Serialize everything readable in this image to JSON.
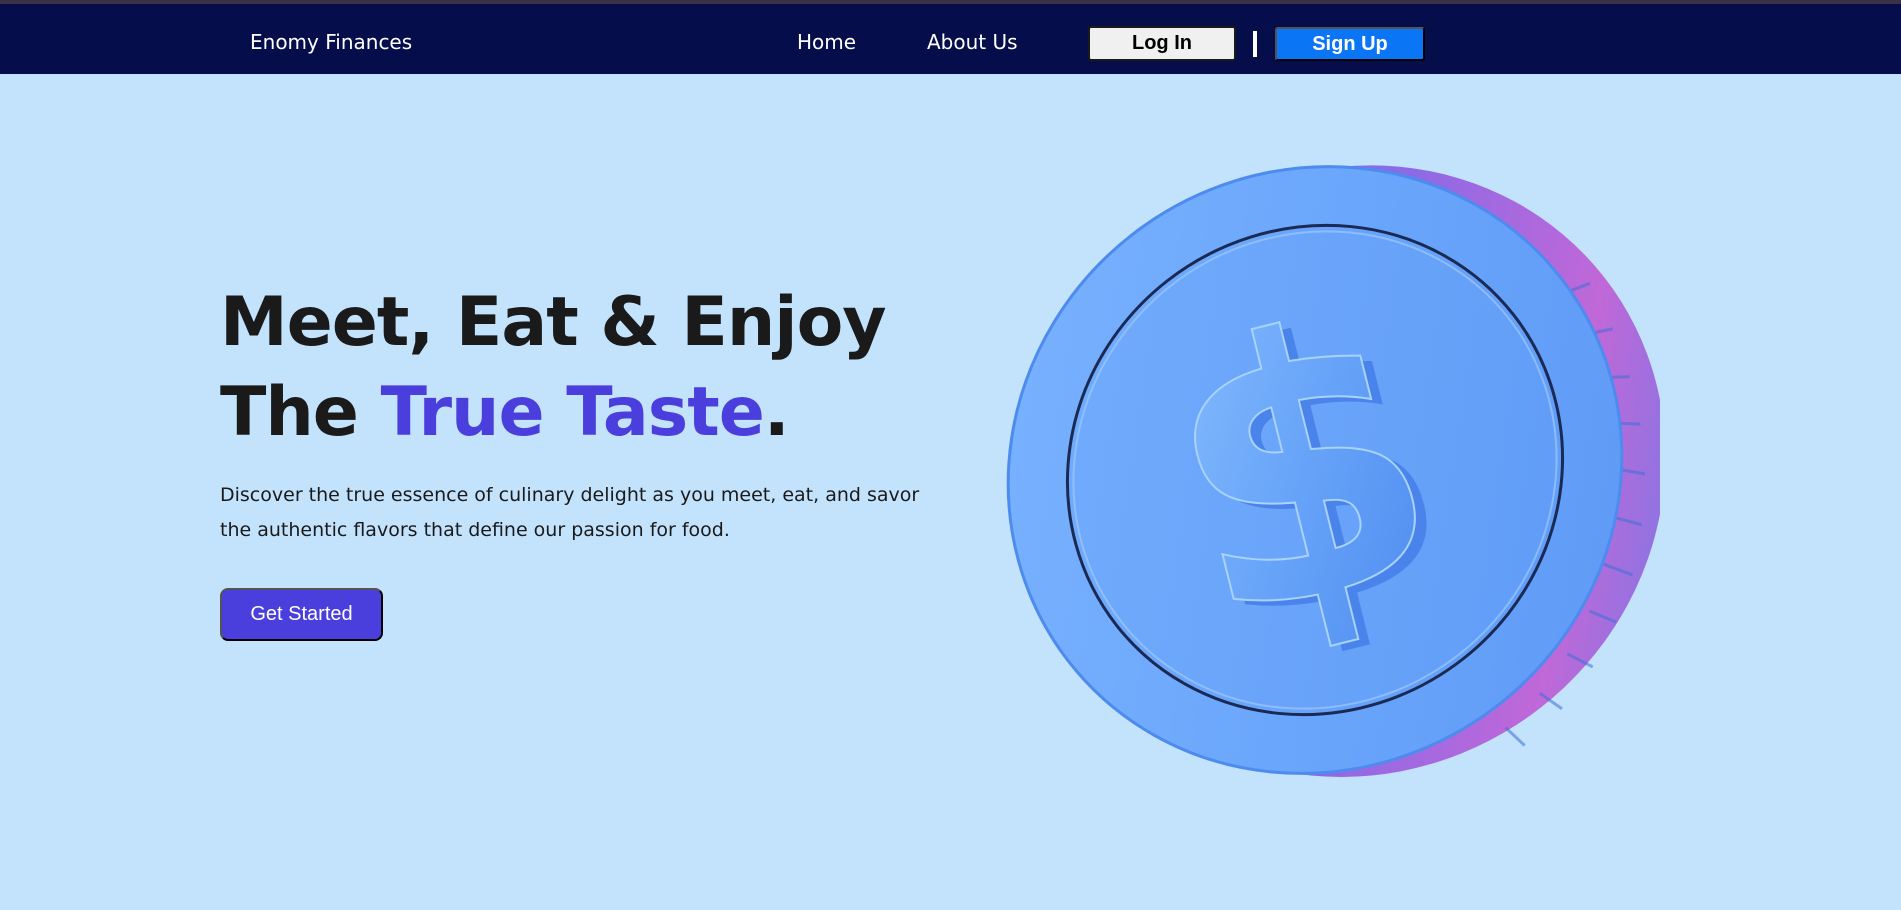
{
  "navbar": {
    "brand": "Enomy Finances",
    "links": [
      {
        "label": "Home"
      },
      {
        "label": "About Us"
      }
    ],
    "login_label": "Log In",
    "signup_label": "Sign Up"
  },
  "hero": {
    "headline_line1": "Meet, Eat & Enjoy",
    "headline_line2_prefix": "The ",
    "headline_line2_accent": "True Taste",
    "headline_line2_suffix": ".",
    "description": "Discover the true essence of culinary delight as you meet, eat, and savor the authentic flavors that define our passion for food.",
    "cta_label": "Get Started"
  },
  "illustration": {
    "icon": "dollar-coin-icon"
  },
  "colors": {
    "navbar_bg": "#050e4b",
    "page_bg": "#c3e3fd",
    "accent": "#4a3fdd",
    "signup_bg": "#0a76f5"
  }
}
